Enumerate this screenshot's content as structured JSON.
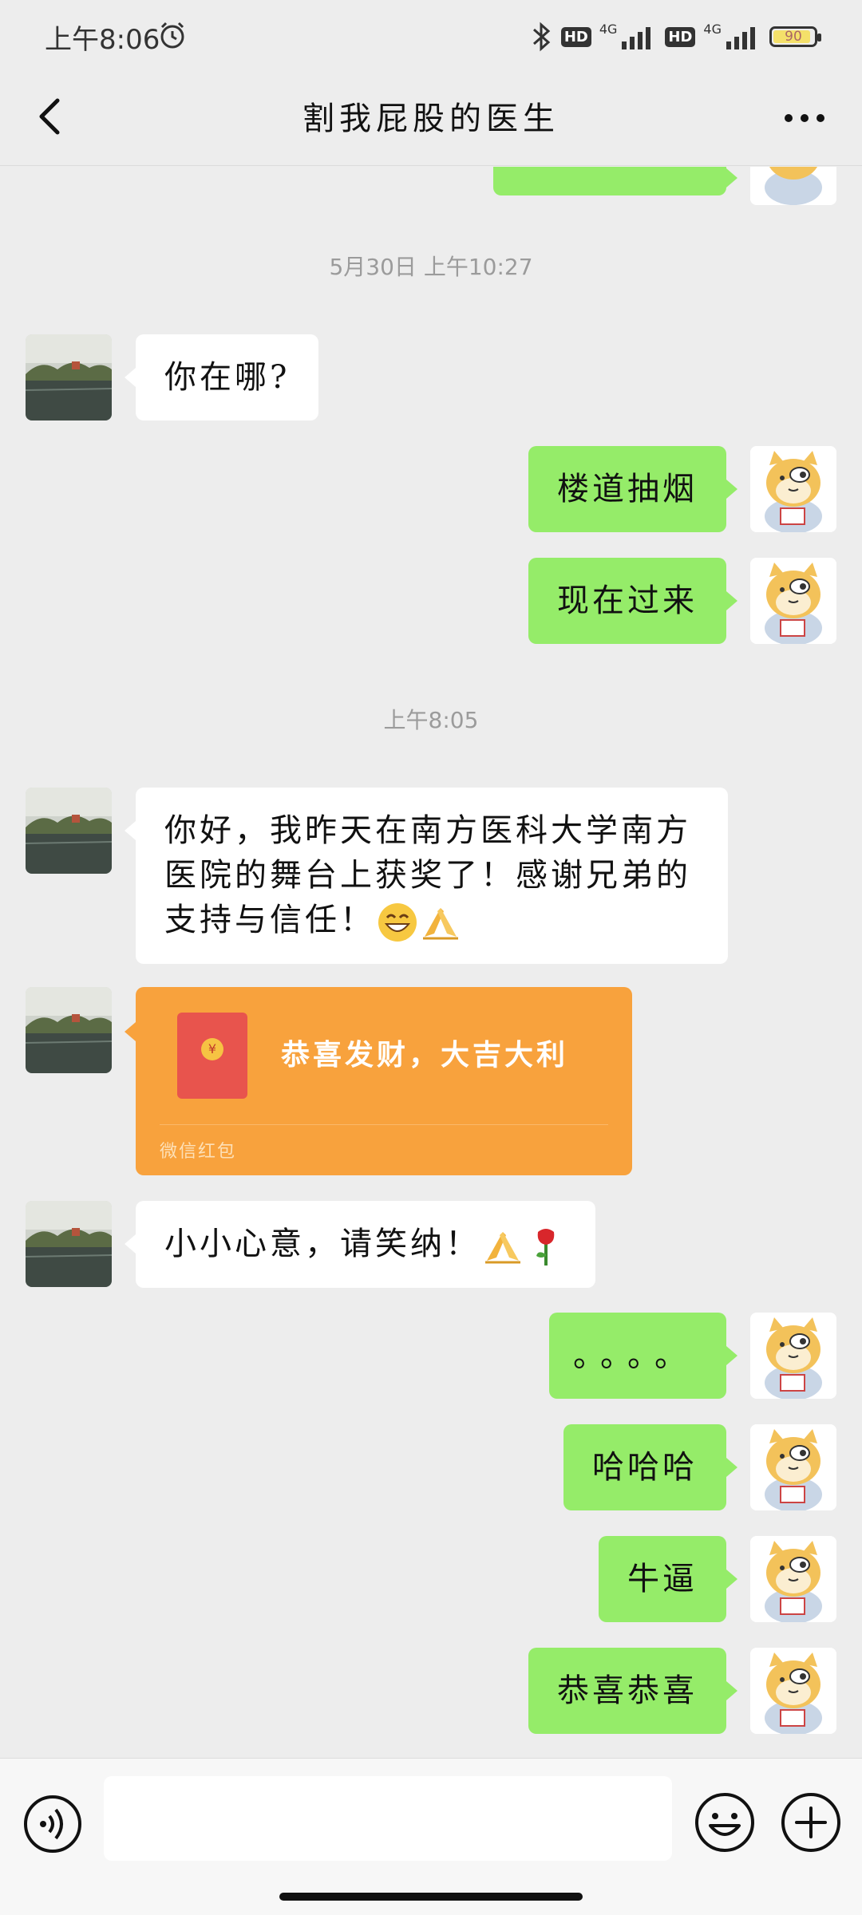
{
  "status_bar": {
    "time": "上午8:06",
    "battery": "90",
    "network_1": "4G",
    "network_2": "4G",
    "hd_1": "HD",
    "hd_2": "HD"
  },
  "nav": {
    "title": "割我屁股的医生"
  },
  "chat": {
    "timestamps": [
      "5月30日 上午10:27",
      "上午8:05"
    ],
    "messages": [
      {
        "from": "friend",
        "text": "你在哪?"
      },
      {
        "from": "me",
        "text": "楼道抽烟"
      },
      {
        "from": "me",
        "text": "现在过来"
      },
      {
        "from": "friend",
        "text": "你好，我昨天在南方医科大学南方医院的舞台上获奖了！感谢兄弟的支持与信任！"
      },
      {
        "from": "friend",
        "type": "red_packet",
        "text": "恭喜发财，大吉大利",
        "label": "微信红包"
      },
      {
        "from": "friend",
        "text": "小小心意，请笑纳！"
      },
      {
        "from": "me",
        "text": "。。。。"
      },
      {
        "from": "me",
        "text": "哈哈哈"
      },
      {
        "from": "me",
        "text": "牛逼"
      },
      {
        "from": "me",
        "text": "恭喜恭喜"
      }
    ]
  },
  "input": {
    "placeholder": ""
  },
  "icons": {
    "back": "chevron-left-icon",
    "more": "more-dots-icon",
    "voice": "voice-icon",
    "emoji": "emoji-icon",
    "plus": "plus-icon"
  },
  "colors": {
    "outgoing_bubble": "#95ec69",
    "incoming_bubble": "#ffffff",
    "red_packet": "#f8a23d",
    "background": "#ededed"
  }
}
